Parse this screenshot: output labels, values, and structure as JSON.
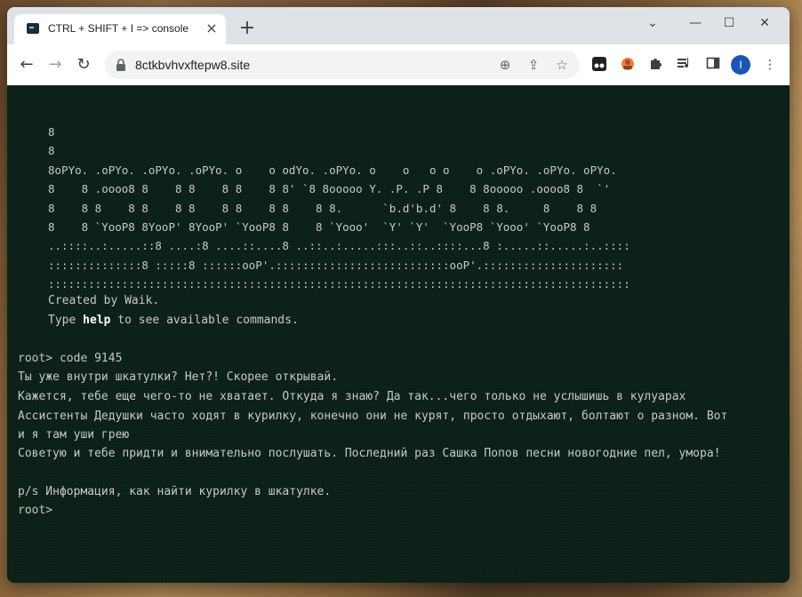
{
  "browser": {
    "tab_title": "CTRL + SHIFT + I => console",
    "url": "8ctkbvhvxftepw8.site",
    "window_controls": [
      "minimize-icon",
      "maximize-icon",
      "close-icon"
    ],
    "profile_initial": "I",
    "close_tab_glyph": "×",
    "new_tab_glyph": "+",
    "collapse_glyph": "⌄",
    "minimize_glyph": "—",
    "maximize_glyph": "☐",
    "close_window_glyph": "✕",
    "back_glyph": "←",
    "forward_glyph": "→",
    "reload_glyph": "↻",
    "zoom_glyph": "⊕",
    "share_glyph": "⇪",
    "bookmark_glyph": "☆",
    "menu_glyph": "⋮"
  },
  "terminal": {
    "ascii_art": [
      "8",
      "8",
      "8oPYo. .oPYo. .oPYo. .oPYo. o    o odYo. .oPYo. o    o   o o    o .oPYo. .oPYo. oPYo.",
      "8    8 .oooo8 8    8 8    8 8    8 8' `8 8ooooo Y. .P. .P 8    8 8ooooo .oooo8 8  `'",
      "8    8 8    8 8    8 8    8 8    8 8    8 8.      `b.d'b.d' 8    8 8.     8    8 8",
      "8    8 `YooP8 8YooP' 8YooP' `YooP8 8    8 `Yooo'  `Y' `Y'  `YooP8 `Yooo' `YooP8 8",
      "..::::..:.....::8 ....:8 ....::....8 ..::..:.....:::..::..::::...8 :.....::.....:..::::",
      "::::::::::::::8 :::::8 ::::::ooP'.::::::::::::::::::::::::::ooP'.:::::::::::::::::::::",
      ":::::::::::::::::::::::::::::::::::::::::::::::::::::::::::::::::::::::::::::::::::::::"
    ],
    "credit": "Created by Waik.",
    "help_prefix": "Type ",
    "help_word": "help",
    "help_suffix": " to see available commands.",
    "prompt_command": "root> code 9145",
    "response_lines": [
      "Ты уже внутри шкатулки? Нет?! Скорее открывай.",
      "Кажется, тебе еще чего-то не хватает. Откуда я знаю? Да так...чего только не услышишь в кулуарах",
      "Ассистенты Дедушки часто ходят в курилку, конечно они не курят, просто отдыхают, болтают о разном. Вот",
      "и я там уши грею",
      "Советую и тебе придти и внимательно послушать. Последний раз Сашка Попов песни новогодние пел, умора!",
      "",
      "p/s Информация, как найти курилку в шкатулке."
    ],
    "current_prompt": "root>"
  }
}
